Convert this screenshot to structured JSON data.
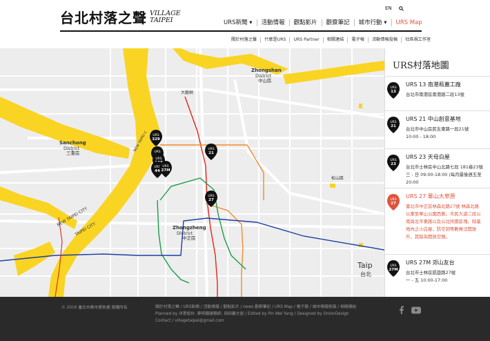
{
  "brand": {
    "logo_zh": "台北村落之聲",
    "logo_en_line1": "VILLAGE",
    "logo_en_line2": "TAIPEI"
  },
  "util": {
    "lang": "EN"
  },
  "nav": [
    {
      "label": "URS新聞 ▾"
    },
    {
      "label": "活動情報"
    },
    {
      "label": "觀點影片"
    },
    {
      "label": "觀察筆記"
    },
    {
      "label": "城市行動 ▾"
    },
    {
      "label": "URS Map"
    }
  ],
  "subnav": [
    "關於村落之聲",
    "什麼是URS",
    "URS Partner",
    "相關連結",
    "電子報",
    "活動情報投稿",
    "社區規工作室"
  ],
  "map": {
    "labels": {
      "zhongshan_en": "Zhongshan",
      "zhongshan_en2": "District",
      "zhongshan_zh": "中山區",
      "sanchong_en": "Sanchong",
      "sanchong_en2": "District",
      "sanchong_zh": "三重區",
      "zhongzheng_en": "Zhongzheng",
      "zhongzheng_en2": "District",
      "zhongzheng_zh": "中正區",
      "newtaipei": "NEW TAIPEI CITY",
      "taipei": "TAIPEI CITY",
      "taipei_right": "Taip",
      "taipei_right_zh": "台北",
      "songshan": "Songshan",
      "songshan_zh": "松山區",
      "datong": "大龍峒",
      "newtaipei2": "NEW TAIPEI C"
    },
    "markers": [
      {
        "line1": "URS",
        "line2": "329"
      },
      {
        "line1": "URS",
        "line2": "13"
      },
      {
        "line1": "URS",
        "line2": "127"
      },
      {
        "line1": "URS",
        "line2": "44"
      },
      {
        "line1": "URS",
        "line2": "27M"
      },
      {
        "line1": "URS",
        "line2": "21"
      },
      {
        "line1": "URS",
        "line2": "27"
      }
    ]
  },
  "sidebar": {
    "title": "URS村落地圖",
    "sites": [
      {
        "badge1": "URS",
        "badge2": "13",
        "name": "URS 13 南港瓶蓋工廠",
        "addr1": "台北市南港區南港路二段13號",
        "addr2": ""
      },
      {
        "badge1": "URS",
        "badge2": "21",
        "name": "URS 21 中山創意基地",
        "addr1": "台北市中山區民生東路一段21號",
        "addr2": "10:00 - 18:00"
      },
      {
        "badge1": "URS",
        "badge2": "23",
        "name": "URS 23 天母白屋",
        "addr1": "台北市士林區中山北路七段 181巷23號",
        "addr2": "三 - 日 09:00-18:00 (每月最後週五至20:00"
      },
      {
        "badge1": "URS",
        "badge2": "27",
        "name": "URS 27 華山大草原",
        "addr1": "臺北市中正區林森北路27號 林森北路",
        "addr2": "以東至華山公園西側，市民大道二段以",
        "addr3": "南與北平東路以及以北所圍區塊，除基",
        "addr4": "地內之小白屋，防空洞等數無法開放",
        "addr5": "外，其餘為開放空間。"
      },
      {
        "badge1": "URS",
        "badge2": "27M",
        "name": "URS 27M 郊山友台",
        "addr1": "台北市士林區凱旋路27號",
        "addr2": "一 - 五 10:00-17:00"
      }
    ]
  },
  "footer": {
    "copyright": "© 2016 臺北市都市更新處 版權所有",
    "links1": "關於村落之聲 / URS新聞 / 活動情報 / 觀點影片 / news 觀察筆記 / URS Map / 電子報 / 城市情報投稿 / 相關連結",
    "links2": "Planned by 洋蔥設計, 蔡明穎建築師, 田田義文創 / Edited by Pin Wei Yang / Designed by OnionDesign",
    "links3": "Contact / villagetaipei@gmail.com"
  },
  "colors": {
    "accent": "#e0533b",
    "river": "#f9d423",
    "footer_bg": "#2a2a2a"
  }
}
